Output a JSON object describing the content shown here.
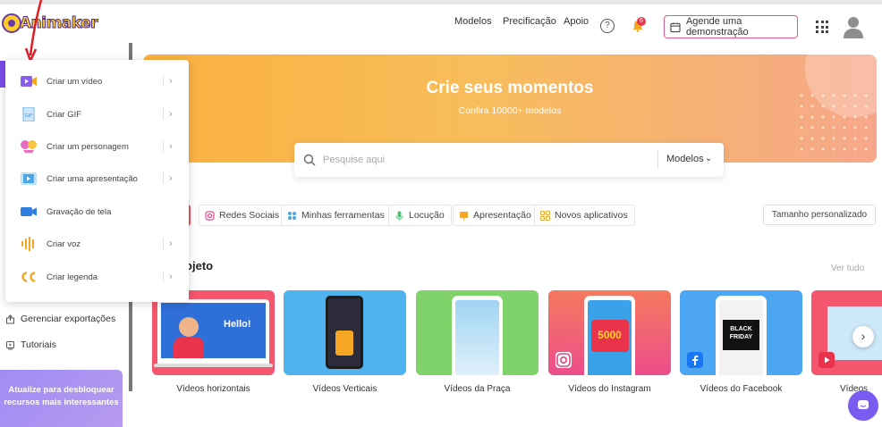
{
  "brand": {
    "name": "Animaker"
  },
  "topnav": {
    "models": "Modelos",
    "pricing": "Precificação",
    "support": "Apoio",
    "help_glyph": "?",
    "notification_count": "6",
    "demo_button": "Agende uma demonstração"
  },
  "create_menu": {
    "items": [
      {
        "label": "Criar um vídeo",
        "icon": "video-icon",
        "has_submenu": true
      },
      {
        "label": "Criar GIF",
        "icon": "gif-icon",
        "has_submenu": true
      },
      {
        "label": "Criar um personagem",
        "icon": "character-icon",
        "has_submenu": true
      },
      {
        "label": "Criar uma apresentação",
        "icon": "presentation-icon",
        "has_submenu": true
      },
      {
        "label": "Gravação de tela",
        "icon": "screen-record-icon",
        "has_submenu": false
      },
      {
        "label": "Criar voz",
        "icon": "voice-icon",
        "has_submenu": true
      },
      {
        "label": "Criar legenda",
        "icon": "subtitle-icon",
        "has_submenu": true
      }
    ],
    "chevron": "›"
  },
  "sidebar": {
    "manage_exports": "Gerenciar exportações",
    "tutorials": "Tutoriais",
    "upgrade": "Atualize para desbloquear recursos mais interessantes"
  },
  "hero": {
    "title": "Crie seus momentos",
    "subtitle": "Confira 10000+ modelos"
  },
  "search": {
    "placeholder": "Pesquise aqui",
    "category": "Modelos",
    "chevron": "⌄"
  },
  "categories": [
    {
      "label": "Redes Sociais",
      "icon": "social-icon",
      "color": "#e84a8a"
    },
    {
      "label": "Minhas ferramentas",
      "icon": "tools-icon",
      "color": "#4aa8e8"
    },
    {
      "label": "Locução",
      "icon": "mic-icon",
      "color": "#4ac27a"
    },
    {
      "label": "Apresentação",
      "icon": "presentation-icon",
      "color": "#f5a623"
    },
    {
      "label": "Novos aplicativos",
      "icon": "apps-icon",
      "color": "#f5a623"
    }
  ],
  "custom_size": "Tamanho personalizado",
  "section": {
    "title": "rojeto",
    "see_all": "Ver tudo"
  },
  "cards": [
    {
      "label": "Vídeos horizontais",
      "bg": "#f4566e",
      "text": "Hello!"
    },
    {
      "label": "Vídeos Verticais",
      "bg": "#4fb3f0"
    },
    {
      "label": "Vídeos da Praça",
      "bg": "#7fd36a"
    },
    {
      "label": "Vídeos do Instagram",
      "bg": "#f47a5e",
      "text": "5000"
    },
    {
      "label": "Vídeos do Facebook",
      "bg": "#4da6f2",
      "text": "BLACK FRIDAY"
    },
    {
      "label": "Vídeos",
      "bg": "#f4566e"
    }
  ],
  "next_glyph": "›"
}
